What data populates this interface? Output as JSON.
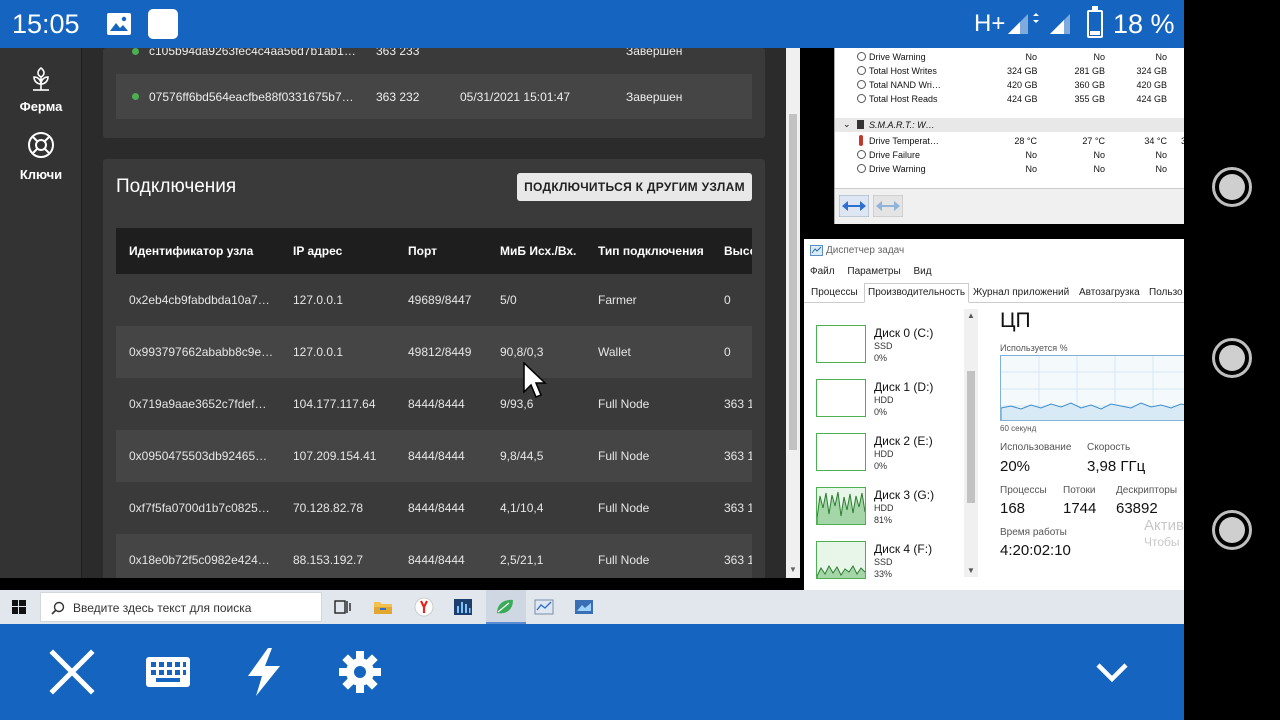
{
  "status_bar": {
    "time": "15:05",
    "network": "H+",
    "battery": "18 %",
    "battery_fraction": 0.18
  },
  "chia": {
    "sidebar": [
      {
        "label": "Ферма",
        "icon": "plant-icon"
      },
      {
        "label": "Ключи",
        "icon": "lifebuoy-icon"
      }
    ],
    "blocks": [
      {
        "hash": "c105b94da9263fec4c4aa56d7b1ab1…",
        "height": "363 233",
        "time": "",
        "status": "Завершен"
      },
      {
        "hash": "07576ff6bd564eacfbe88f0331675b7…",
        "height": "363 232",
        "time": "05/31/2021 15:01:47",
        "status": "Завершен"
      }
    ],
    "connections": {
      "title": "Подключения",
      "connect_button": "ПОДКЛЮЧИТЬСЯ К ДРУГИМ УЗЛАМ",
      "columns": [
        "Идентификатор узла",
        "IP адрес",
        "Порт",
        "МиБ Исх./Вх.",
        "Тип подключения",
        "Высо"
      ],
      "rows": [
        {
          "id": "0x2eb4cb9fabdbda10a7…",
          "ip": "127.0.0.1",
          "port": "49689/8447",
          "mib": "5/0",
          "type": "Farmer",
          "height": "0"
        },
        {
          "id": "0x993797662ababb8c9e…",
          "ip": "127.0.0.1",
          "port": "49812/8449",
          "mib": "90,8/0,3",
          "type": "Wallet",
          "height": "0"
        },
        {
          "id": "0x719a9aae3652c7fdef…",
          "ip": "104.177.117.64",
          "port": "8444/8444",
          "mib": "9/93,6",
          "type": "Full Node",
          "height": "363 1"
        },
        {
          "id": "0x0950475503db92465…",
          "ip": "107.209.154.41",
          "port": "8444/8444",
          "mib": "9,8/44,5",
          "type": "Full Node",
          "height": "363 1"
        },
        {
          "id": "0xf7f5fa0700d1b7c0825…",
          "ip": "70.128.82.78",
          "port": "8444/8444",
          "mib": "4,1/10,4",
          "type": "Full Node",
          "height": "363 1"
        },
        {
          "id": "0x18e0b72f5c0982e424…",
          "ip": "88.153.192.7",
          "port": "8444/8444",
          "mib": "2,5/21,1",
          "type": "Full Node",
          "height": "363 1"
        }
      ]
    }
  },
  "hwinfo": {
    "rows": [
      {
        "name": "Drive Warning",
        "v1": "No",
        "v2": "No",
        "v3": "No",
        "v4": ""
      },
      {
        "name": "Total Host Writes",
        "v1": "324 GB",
        "v2": "281 GB",
        "v3": "324 GB",
        "v4": ""
      },
      {
        "name": "Total NAND Wri…",
        "v1": "420 GB",
        "v2": "360 GB",
        "v3": "420 GB",
        "v4": ""
      },
      {
        "name": "Total Host Reads",
        "v1": "424 GB",
        "v2": "355 GB",
        "v3": "424 GB",
        "v4": ""
      }
    ],
    "group": "S.M.A.R.T.: W…",
    "group_rows": [
      {
        "name": "Drive Temperat…",
        "v1": "28 °C",
        "v2": "27 °C",
        "v3": "34 °C",
        "v4": "3"
      },
      {
        "name": "Drive Failure",
        "v1": "No",
        "v2": "No",
        "v3": "No",
        "v4": ""
      },
      {
        "name": "Drive Warning",
        "v1": "No",
        "v2": "No",
        "v3": "No",
        "v4": ""
      }
    ]
  },
  "task_manager": {
    "title": "Диспетчер задач",
    "menu": [
      "Файл",
      "Параметры",
      "Вид"
    ],
    "tabs": [
      "Процессы",
      "Производительность",
      "Журнал приложений",
      "Автозагрузка",
      "Пользо"
    ],
    "active_tab": "Производительность",
    "disks": [
      {
        "name": "Диск 0 (C:)",
        "type": "SSD",
        "percent": "0%"
      },
      {
        "name": "Диск 1 (D:)",
        "type": "HDD",
        "percent": "0%"
      },
      {
        "name": "Диск 2 (E:)",
        "type": "HDD",
        "percent": "0%"
      },
      {
        "name": "Диск 3 (G:)",
        "type": "HDD",
        "percent": "81%"
      },
      {
        "name": "Диск 4 (F:)",
        "type": "SSD",
        "percent": "33%"
      }
    ],
    "cpu": {
      "title": "ЦП",
      "used_label": "Используется %",
      "axis_label": "60 секунд",
      "usage_label": "Использование",
      "usage": "20%",
      "speed_label": "Скорость",
      "speed": "3,98 ГГц",
      "proc_label": "Процессы",
      "proc": "168",
      "threads_label": "Потоки",
      "threads": "1744",
      "handles_label": "Дескрипторы",
      "handles": "63892",
      "uptime_label": "Время работы",
      "uptime": "4:20:02:10"
    },
    "activation": [
      "Активі",
      "Чтобы"
    ]
  },
  "taskbar": {
    "search_placeholder": "Введите здесь текст для поиска"
  },
  "colors": {
    "android_blue": "#1565c0",
    "chia_bg": "#2b2b2b",
    "chia_green": "#4caf50"
  }
}
